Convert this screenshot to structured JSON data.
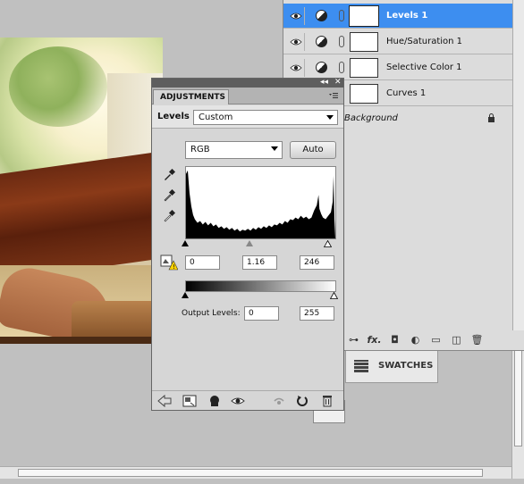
{
  "layers": {
    "items": [
      {
        "name": "Levels 1",
        "selected": true
      },
      {
        "name": "Hue/Saturation 1",
        "selected": false
      },
      {
        "name": "Selective Color 1",
        "selected": false
      },
      {
        "name": "Curves 1",
        "selected": false
      }
    ],
    "background_name": "Background",
    "footer_icons": [
      "link-icon",
      "fx-icon",
      "mask-icon",
      "adjustment-icon",
      "group-icon",
      "new-layer-icon",
      "trash-icon"
    ],
    "fx_label": "fx."
  },
  "swatches": {
    "label": "SWATCHES"
  },
  "adjustments": {
    "tab_label": "ADJUSTMENTS",
    "panel_label": "Levels",
    "preset": "Custom",
    "channel": "RGB",
    "auto_label": "Auto",
    "input_black": "0",
    "input_gamma": "1.16",
    "input_white": "246",
    "output_label": "Output Levels:",
    "output_black": "0",
    "output_white": "255",
    "input_black_level": 0,
    "input_gamma_level": 1.16,
    "input_white_level": 246,
    "output_black_level": 0,
    "output_white_level": 255
  },
  "colors": {
    "selection": "#3d8ef0",
    "panel": "#d6d6d6"
  }
}
